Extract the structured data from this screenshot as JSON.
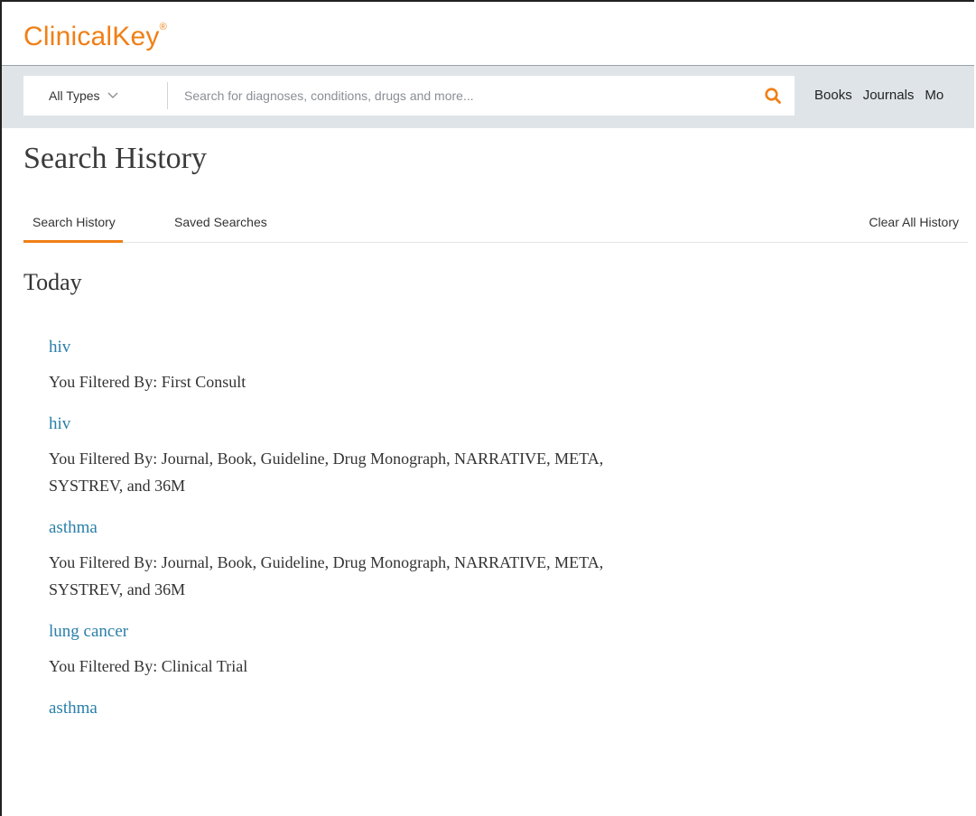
{
  "app": {
    "logo_text": "ClinicalKey",
    "logo_mark": "®",
    "brand_color": "#f07f16"
  },
  "search": {
    "type_label": "All Types",
    "placeholder": "Search for diagnoses, conditions, drugs and more...",
    "value": ""
  },
  "nav": {
    "items": [
      "Books",
      "Journals",
      "Mo"
    ]
  },
  "page": {
    "title": "Search History"
  },
  "tabs": {
    "search_history": "Search History",
    "saved_searches": "Saved Searches",
    "active": "Search History",
    "clear_all": "Clear All History"
  },
  "history": {
    "section": "Today",
    "entries": [
      {
        "query": "hiv",
        "filter": "You Filtered By: First Consult"
      },
      {
        "query": "hiv",
        "filter_line1": "You Filtered By: Journal, Book, Guideline, Drug Monograph, NARRATIVE, META,",
        "filter_line2": "SYSTREV, and 36M"
      },
      {
        "query": "asthma",
        "filter_line1": "You Filtered By: Journal, Book, Guideline, Drug Monograph, NARRATIVE, META,",
        "filter_line2": "SYSTREV, and 36M"
      },
      {
        "query": "lung cancer",
        "filter": "You Filtered By: Clinical Trial"
      },
      {
        "query": "asthma"
      }
    ]
  },
  "icons": {
    "search": "search-icon",
    "dropdown": "chevron-down-icon"
  },
  "colors": {
    "link": "#2a7fa8",
    "search_band": "#dfe4e8",
    "accent": "#f07f16"
  }
}
